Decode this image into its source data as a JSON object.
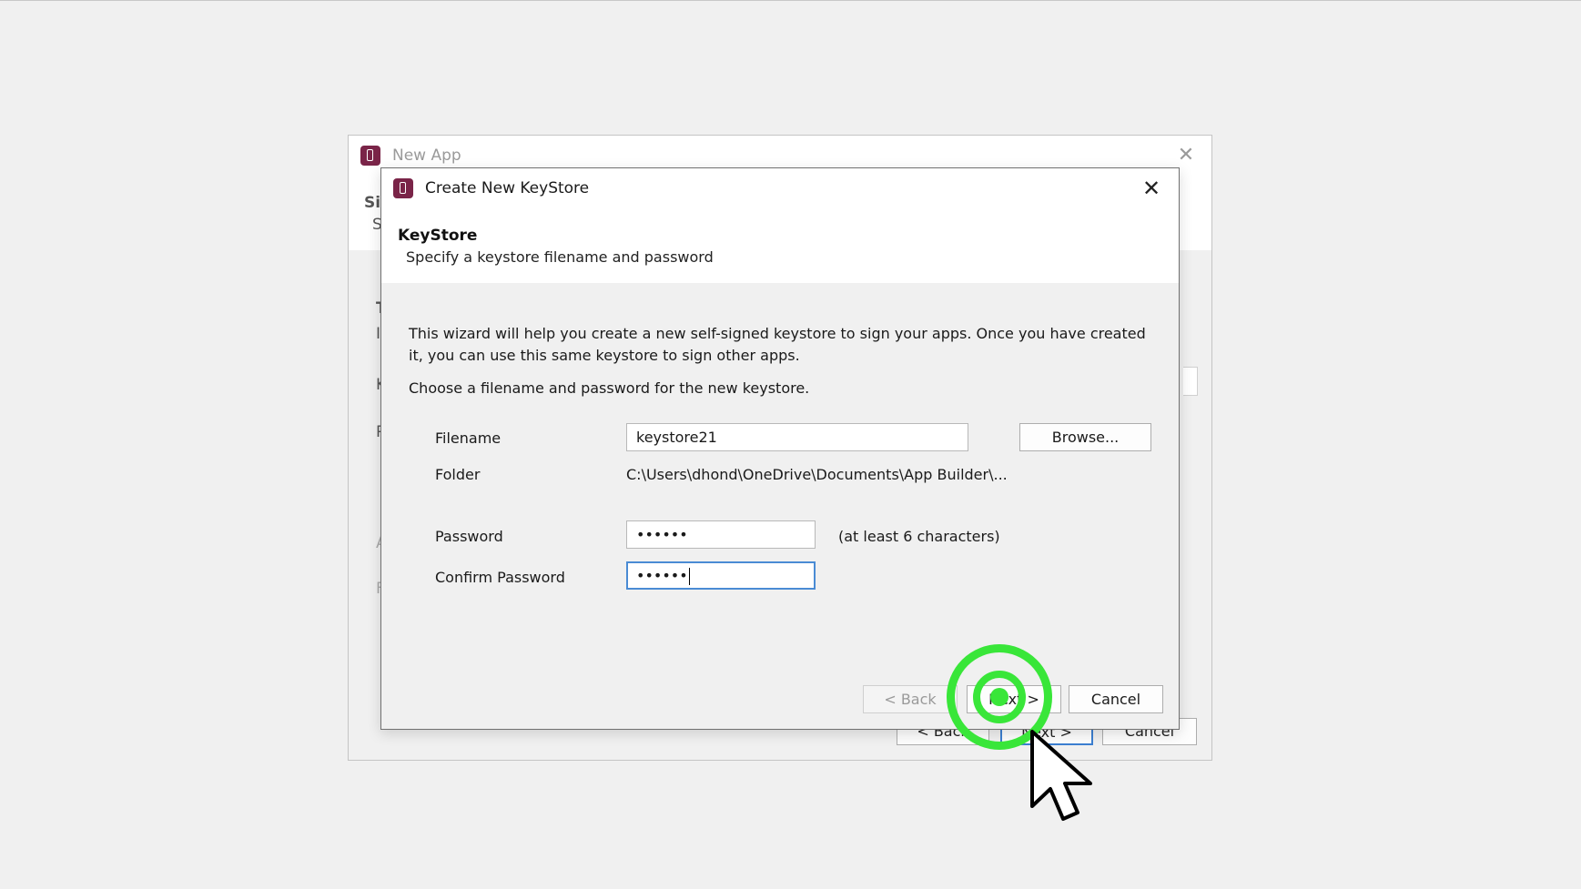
{
  "background_window": {
    "title": "New App",
    "peek_letters": [
      "Si",
      "S",
      "T",
      "I",
      "K",
      "P",
      "A",
      "F"
    ],
    "buttons": {
      "back": "< Back",
      "next": "Next >",
      "cancel": "Cancel"
    }
  },
  "dialog": {
    "title": "Create New KeyStore",
    "section_title": "KeyStore",
    "section_subtitle": "Specify a keystore filename and password",
    "intro_text": "This wizard will help you create a new self-signed keystore to sign your apps. Once you have created it, you can use this same keystore to sign other apps.",
    "instruction_text": "Choose a filename and password for the new keystore.",
    "fields": {
      "filename_label": "Filename",
      "filename_value": "keystore21",
      "browse_label": "Browse...",
      "folder_label": "Folder",
      "folder_value": "C:\\Users\\dhond\\OneDrive\\Documents\\App Builder\\...",
      "password_label": "Password",
      "password_value": "••••••",
      "password_hint": "(at least 6 characters)",
      "confirm_label": "Confirm Password",
      "confirm_value": "••••••"
    },
    "buttons": {
      "back": "< Back",
      "next": "Next >",
      "cancel": "Cancel"
    }
  },
  "colors": {
    "app_icon": "#7a2448",
    "focus_border": "#4a8bd4",
    "click_indicator": "#39e639"
  },
  "icons": {
    "app": "app-icon",
    "close": "close-icon",
    "cursor": "mouse-cursor-icon",
    "click": "click-indicator"
  }
}
